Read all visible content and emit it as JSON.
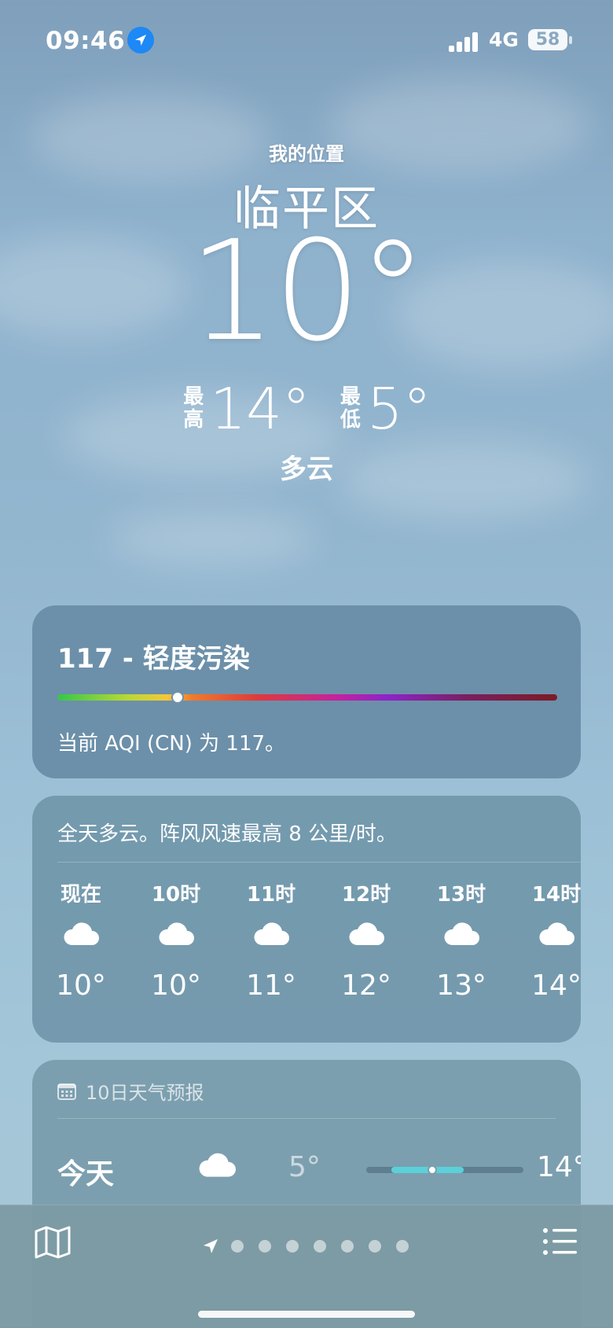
{
  "status_bar": {
    "time": "09:46",
    "network": "4G",
    "battery": "58"
  },
  "header": {
    "my_location": "我的位置",
    "city": "临平区",
    "temperature": "10°",
    "high_tag": "最高",
    "high": "14°",
    "low_tag": "最低",
    "low": "5°",
    "condition": "多云"
  },
  "aqi": {
    "title": "117 - 轻度污染",
    "indicator_fraction": 0.24,
    "description": "当前 AQI (CN) 为 117。"
  },
  "hourly": {
    "summary": "全天多云。阵风风速最高 8 公里/时。",
    "hours": [
      {
        "label": "现在",
        "icon": "cloud-icon",
        "temp": "10°"
      },
      {
        "label": "10时",
        "icon": "cloud-icon",
        "temp": "10°"
      },
      {
        "label": "11时",
        "icon": "cloud-icon",
        "temp": "11°"
      },
      {
        "label": "12时",
        "icon": "cloud-icon",
        "temp": "12°"
      },
      {
        "label": "13时",
        "icon": "cloud-icon",
        "temp": "13°"
      },
      {
        "label": "14时",
        "icon": "cloud-icon",
        "temp": "14°"
      }
    ]
  },
  "forecast": {
    "title": "10日天气预报",
    "rows": [
      {
        "day": "今天",
        "icon": "cloud-icon",
        "low": "5°",
        "high": "14°",
        "range_start_fraction": 0.16,
        "range_end_fraction": 0.62,
        "current_fraction": 0.42
      }
    ]
  },
  "bottom_bar": {
    "page_count": 7,
    "current_page": "location"
  },
  "colors": {
    "aqi_green": "#35c74a",
    "aqi_red": "#e0393c",
    "aqi_purple": "#8e24c8",
    "forecast_bar": "#5cd0d8",
    "location_blue": "#1e88f5"
  }
}
